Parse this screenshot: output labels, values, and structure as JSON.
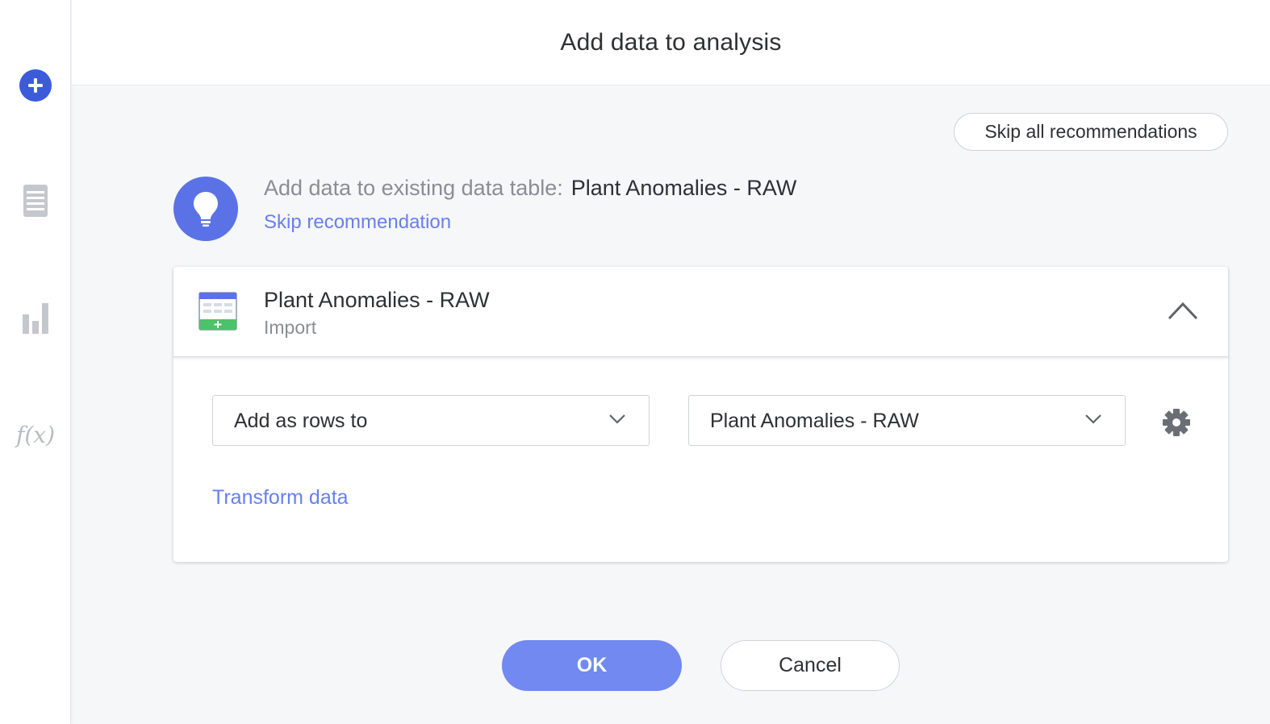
{
  "sidebar": {
    "icons": [
      {
        "name": "add-data-icon"
      },
      {
        "name": "data-table-icon"
      },
      {
        "name": "visualization-icon"
      },
      {
        "name": "expression-icon",
        "label": "f(x)"
      }
    ]
  },
  "header": {
    "title": "Add data to analysis"
  },
  "recommendations": {
    "skip_all_label": "Skip all recommendations",
    "prefix": "Add data to existing data table:",
    "target_table": "Plant Anomalies - RAW",
    "skip_label": "Skip recommendation"
  },
  "card": {
    "title": "Plant Anomalies - RAW",
    "subtitle": "Import",
    "method_select": {
      "value": "Add as rows to"
    },
    "table_select": {
      "value": "Plant Anomalies - RAW"
    },
    "transform_label": "Transform data"
  },
  "footer": {
    "ok_label": "OK",
    "cancel_label": "Cancel"
  },
  "colors": {
    "accent": "#5b72e6",
    "link": "#6680f0",
    "primary_button": "#7189f0",
    "sidebar_add": "#3b5bdb",
    "table_icon_green": "#4cc26a"
  }
}
